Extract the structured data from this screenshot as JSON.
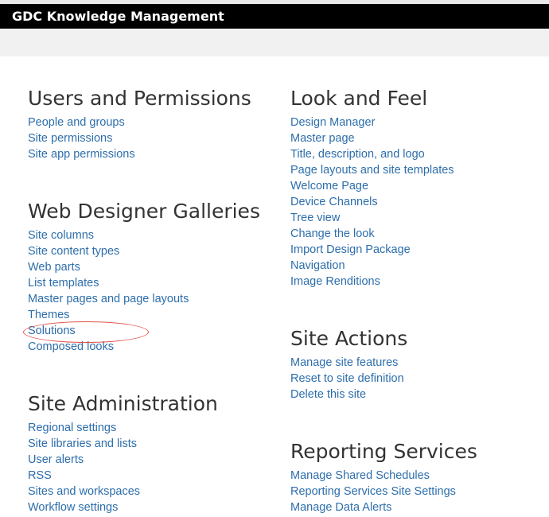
{
  "site": {
    "title": "GDC Knowledge Management"
  },
  "sections": {
    "users": {
      "title": "Users and Permissions",
      "links": [
        "People and groups",
        "Site permissions",
        "Site app permissions"
      ]
    },
    "galleries": {
      "title": "Web Designer Galleries",
      "links": [
        "Site columns",
        "Site content types",
        "Web parts",
        "List templates",
        "Master pages and page layouts",
        "Themes",
        "Solutions",
        "Composed looks"
      ]
    },
    "admin": {
      "title": "Site Administration",
      "links": [
        "Regional settings",
        "Site libraries and lists",
        "User alerts",
        "RSS",
        "Sites and workspaces",
        "Workflow settings"
      ]
    },
    "look": {
      "title": "Look and Feel",
      "links": [
        "Design Manager",
        "Master page",
        "Title, description, and logo",
        "Page layouts and site templates",
        "Welcome Page",
        "Device Channels",
        "Tree view",
        "Change the look",
        "Import Design Package",
        "Navigation",
        "Image Renditions"
      ]
    },
    "actions": {
      "title": "Site Actions",
      "links": [
        "Manage site features",
        "Reset to site definition",
        "Delete this site"
      ]
    },
    "reporting": {
      "title": "Reporting Services",
      "links": [
        "Manage Shared Schedules",
        "Reporting Services Site Settings",
        "Manage Data Alerts"
      ]
    }
  },
  "colors": {
    "link": "#2d6eab",
    "heading": "#333333",
    "highlight": "#e0534d"
  }
}
